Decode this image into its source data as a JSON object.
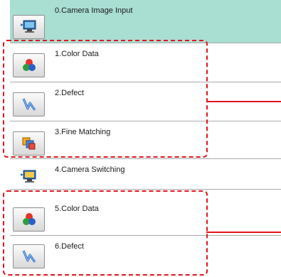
{
  "steps": [
    {
      "label": "0.Camera Image Input",
      "icon": "camera-input-icon",
      "state": "selected"
    },
    {
      "label": "1.Color Data",
      "icon": "color-data-icon",
      "state": "grouped"
    },
    {
      "label": "2.Defect",
      "icon": "defect-icon",
      "state": "grouped"
    },
    {
      "label": "3.Fine Matching",
      "icon": "fine-matching-icon",
      "state": "grouped"
    },
    {
      "label": "4.Camera Switching",
      "icon": "camera-switching-icon",
      "state": "normal"
    },
    {
      "label": "5.Color Data",
      "icon": "color-data-icon",
      "state": "grouped"
    },
    {
      "label": "6.Defect",
      "icon": "defect-icon",
      "state": "grouped"
    }
  ],
  "colors": {
    "selected_row": "#a9ded3",
    "highlight": "#e0161d",
    "row_border": "#a9a9a9"
  }
}
